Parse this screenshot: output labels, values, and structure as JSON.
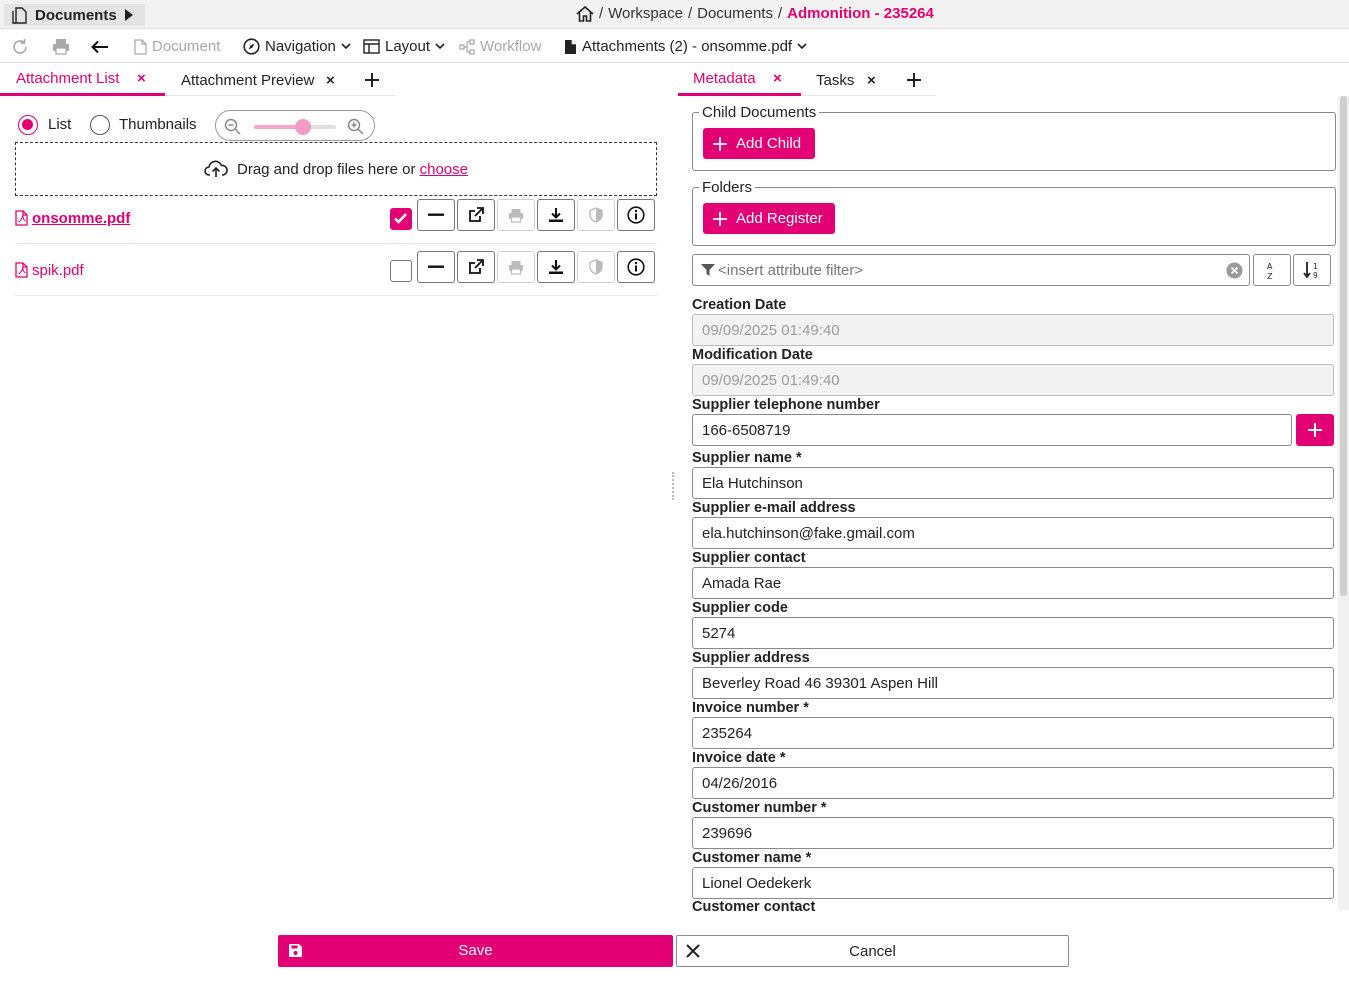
{
  "titlebar": {
    "app_label": "Documents",
    "breadcrumb": {
      "sep": "/",
      "workspace": "Workspace",
      "documents": "Documents",
      "current": "Admonition - 235264"
    }
  },
  "toolbar": {
    "document_label": "Document",
    "navigation_label": "Navigation",
    "layout_label": "Layout",
    "workflow_label": "Workflow",
    "attachments_label": "Attachments (2) - onsomme.pdf"
  },
  "left_tabs": {
    "tabs": [
      {
        "label": "Attachment List",
        "close": "×",
        "active": true
      },
      {
        "label": "Attachment Preview",
        "close": "×",
        "active": false
      }
    ]
  },
  "view_mode": {
    "list_label": "List",
    "thumbnails_label": "Thumbnails",
    "selected": "List",
    "zoom_level": 0.6
  },
  "dropzone": {
    "text": "Drag and drop files here or",
    "link": "choose"
  },
  "files": [
    {
      "name": "onsomme.pdf",
      "checked": true,
      "active": true
    },
    {
      "name": "spik.pdf",
      "checked": false,
      "active": false
    }
  ],
  "right_tabs": {
    "tabs": [
      {
        "label": "Metadata",
        "close": "×",
        "active": true
      },
      {
        "label": "Tasks",
        "close": "×",
        "active": false
      }
    ]
  },
  "child_documents": {
    "legend": "Child Documents",
    "add_label": "Add Child"
  },
  "folders": {
    "legend": "Folders",
    "add_label": "Add Register"
  },
  "filter": {
    "placeholder": "<insert attribute filter>"
  },
  "fields": [
    {
      "label": "Creation Date",
      "value": "09/09/2025 01:49:40",
      "readonly": true
    },
    {
      "label": "Modification Date",
      "value": "09/09/2025 01:49:40",
      "readonly": true
    },
    {
      "label": "Supplier telephone number",
      "value": "166-6508719",
      "readonly": false
    },
    {
      "label": "Supplier name *",
      "value": "Ela Hutchinson",
      "readonly": false
    },
    {
      "label": "Supplier e-mail address",
      "value": "ela.hutchinson@fake.gmail.com",
      "readonly": false
    },
    {
      "label": "Supplier contact",
      "value": "Amada Rae",
      "readonly": false
    },
    {
      "label": "Supplier code",
      "value": "5274",
      "readonly": false
    },
    {
      "label": "Supplier address",
      "value": "Beverley Road 46 39301 Aspen Hill",
      "readonly": false
    },
    {
      "label": "Invoice number *",
      "value": "235264",
      "readonly": false
    },
    {
      "label": "Invoice date *",
      "value": "04/26/2016",
      "readonly": false
    },
    {
      "label": "Customer number *",
      "value": "239696",
      "readonly": false
    },
    {
      "label": "Customer name *",
      "value": "Lionel Oedekerk",
      "readonly": false
    },
    {
      "label": "Customer contact",
      "value": "",
      "readonly": false
    }
  ],
  "footer": {
    "save_label": "Save",
    "cancel_label": "Cancel"
  },
  "colors": {
    "accent": "#e20074",
    "accent_light": "#f49ac6"
  }
}
